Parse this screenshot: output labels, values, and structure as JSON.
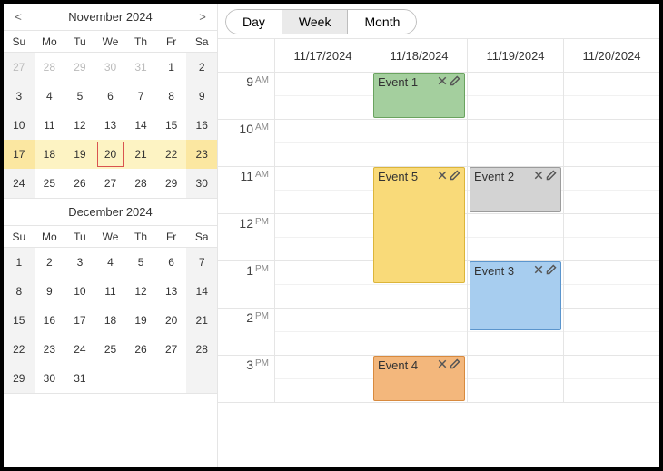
{
  "viewSwitch": {
    "day": "Day",
    "week": "Week",
    "month": "Month",
    "active": "week"
  },
  "miniCalendars": [
    {
      "title": "November 2024",
      "hasNav": true,
      "prev": "<",
      "next": ">",
      "dow": [
        "Su",
        "Mo",
        "Tu",
        "We",
        "Th",
        "Fr",
        "Sa"
      ],
      "weeks": [
        [
          {
            "n": "27",
            "other": true
          },
          {
            "n": "28",
            "other": true
          },
          {
            "n": "29",
            "other": true
          },
          {
            "n": "30",
            "other": true
          },
          {
            "n": "31",
            "other": true
          },
          {
            "n": "1"
          },
          {
            "n": "2"
          }
        ],
        [
          {
            "n": "3"
          },
          {
            "n": "4"
          },
          {
            "n": "5"
          },
          {
            "n": "6"
          },
          {
            "n": "7"
          },
          {
            "n": "8"
          },
          {
            "n": "9"
          }
        ],
        [
          {
            "n": "10"
          },
          {
            "n": "11"
          },
          {
            "n": "12"
          },
          {
            "n": "13"
          },
          {
            "n": "14"
          },
          {
            "n": "15"
          },
          {
            "n": "16"
          }
        ],
        [
          {
            "n": "17",
            "hl": true
          },
          {
            "n": "18",
            "hl": true
          },
          {
            "n": "19",
            "hl": true
          },
          {
            "n": "20",
            "hl": true,
            "today": true
          },
          {
            "n": "21",
            "hl": true
          },
          {
            "n": "22",
            "hl": true
          },
          {
            "n": "23",
            "hl": true
          }
        ],
        [
          {
            "n": "24"
          },
          {
            "n": "25"
          },
          {
            "n": "26"
          },
          {
            "n": "27"
          },
          {
            "n": "28"
          },
          {
            "n": "29"
          },
          {
            "n": "30"
          }
        ]
      ]
    },
    {
      "title": "December 2024",
      "hasNav": false,
      "dow": [
        "Su",
        "Mo",
        "Tu",
        "We",
        "Th",
        "Fr",
        "Sa"
      ],
      "weeks": [
        [
          {
            "n": "1"
          },
          {
            "n": "2"
          },
          {
            "n": "3"
          },
          {
            "n": "4"
          },
          {
            "n": "5"
          },
          {
            "n": "6"
          },
          {
            "n": "7"
          }
        ],
        [
          {
            "n": "8"
          },
          {
            "n": "9"
          },
          {
            "n": "10"
          },
          {
            "n": "11"
          },
          {
            "n": "12"
          },
          {
            "n": "13"
          },
          {
            "n": "14"
          }
        ],
        [
          {
            "n": "15"
          },
          {
            "n": "16"
          },
          {
            "n": "17"
          },
          {
            "n": "18"
          },
          {
            "n": "19"
          },
          {
            "n": "20"
          },
          {
            "n": "21"
          }
        ],
        [
          {
            "n": "22"
          },
          {
            "n": "23"
          },
          {
            "n": "24"
          },
          {
            "n": "25"
          },
          {
            "n": "26"
          },
          {
            "n": "27"
          },
          {
            "n": "28"
          }
        ],
        [
          {
            "n": "29"
          },
          {
            "n": "30"
          },
          {
            "n": "31"
          },
          {
            "n": "",
            "blank": true
          },
          {
            "n": "",
            "blank": true
          },
          {
            "n": "",
            "blank": true
          },
          {
            "n": "",
            "blank": true
          }
        ]
      ]
    }
  ],
  "scheduler": {
    "dayHeaders": [
      "11/17/2024",
      "11/18/2024",
      "11/19/2024",
      "11/20/2024"
    ],
    "hours": [
      {
        "h": "9",
        "ap": "AM"
      },
      {
        "h": "10",
        "ap": "AM"
      },
      {
        "h": "11",
        "ap": "AM"
      },
      {
        "h": "12",
        "ap": "PM"
      },
      {
        "h": "1",
        "ap": "PM"
      },
      {
        "h": "2",
        "ap": "PM"
      },
      {
        "h": "3",
        "ap": "PM"
      }
    ],
    "events": [
      {
        "title": "Event 1",
        "day": 1,
        "startHour": 9,
        "durationHours": 1,
        "color": "green"
      },
      {
        "title": "Event 5",
        "day": 1,
        "startHour": 11,
        "durationHours": 2.5,
        "color": "yellow"
      },
      {
        "title": "Event 4",
        "day": 1,
        "startHour": 15,
        "durationHours": 1,
        "color": "orange"
      },
      {
        "title": "Event 2",
        "day": 2,
        "startHour": 11,
        "durationHours": 1,
        "color": "gray"
      },
      {
        "title": "Event 3",
        "day": 2,
        "startHour": 13,
        "durationHours": 1.5,
        "color": "blue"
      }
    ]
  }
}
